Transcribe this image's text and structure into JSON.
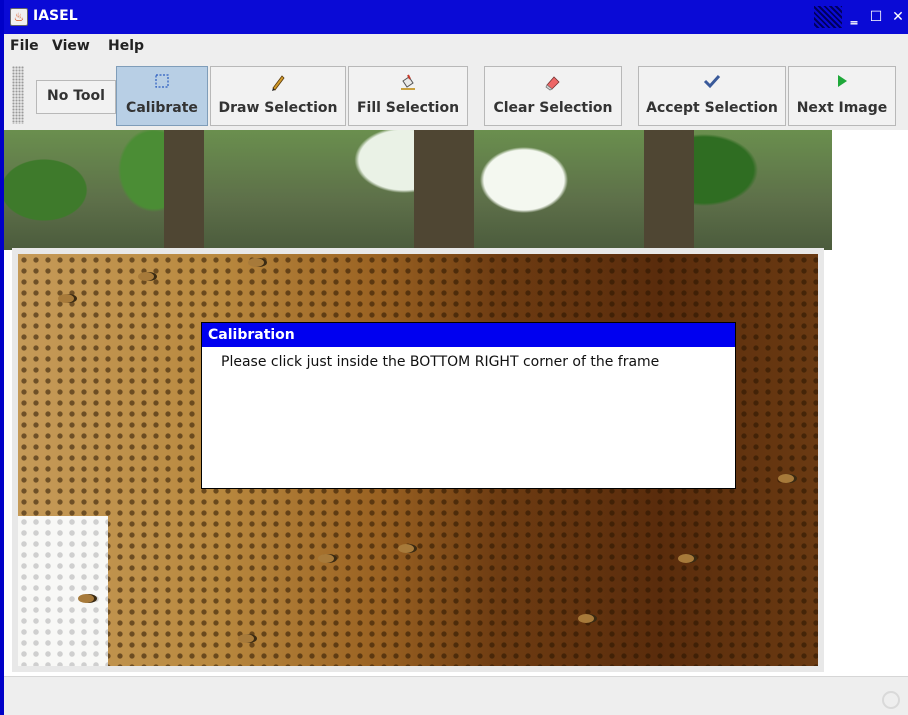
{
  "window": {
    "title": "IASEL"
  },
  "menubar": {
    "items": [
      {
        "id": "file",
        "label": "File"
      },
      {
        "id": "view",
        "label": "View"
      },
      {
        "id": "help",
        "label": "Help"
      }
    ]
  },
  "toolbar": {
    "buttons": [
      {
        "id": "no-tool",
        "label": "No Tool",
        "icon": "",
        "active": false
      },
      {
        "id": "calibrate",
        "label": "Calibrate",
        "icon": "calibrate-icon",
        "active": true
      },
      {
        "id": "draw-selection",
        "label": "Draw Selection",
        "icon": "pencil-icon",
        "active": false
      },
      {
        "id": "fill-selection",
        "label": "Fill Selection",
        "icon": "paint-bucket-icon",
        "active": false
      },
      {
        "id": "clear-selection",
        "label": "Clear Selection",
        "icon": "eraser-icon",
        "active": false
      },
      {
        "id": "accept-selection",
        "label": "Accept Selection",
        "icon": "checkmark-icon",
        "active": false
      },
      {
        "id": "next-image",
        "label": "Next Image",
        "icon": "play-arrow-icon",
        "active": false
      }
    ]
  },
  "dialog": {
    "title": "Calibration",
    "message": "Please click just inside the BOTTOM RIGHT corner of the frame"
  },
  "colors": {
    "titlebar": "#0a0ad6",
    "dialog_title": "#0000f0",
    "active_button": "#b8cfe5"
  }
}
